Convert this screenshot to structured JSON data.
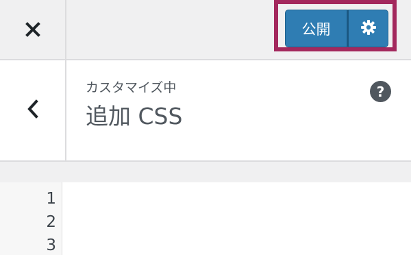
{
  "header": {
    "close_icon": "close-icon",
    "publish_label": "公開",
    "settings_icon": "gear-icon"
  },
  "section": {
    "back_icon": "chevron-left-icon",
    "customizing_label": "カスタマイズ中",
    "title": "追加 CSS",
    "help_symbol": "?"
  },
  "editor": {
    "line_numbers": [
      "1",
      "2",
      "3"
    ]
  },
  "colors": {
    "highlight": "#a3285d",
    "primary_button": "#2f7db3"
  }
}
